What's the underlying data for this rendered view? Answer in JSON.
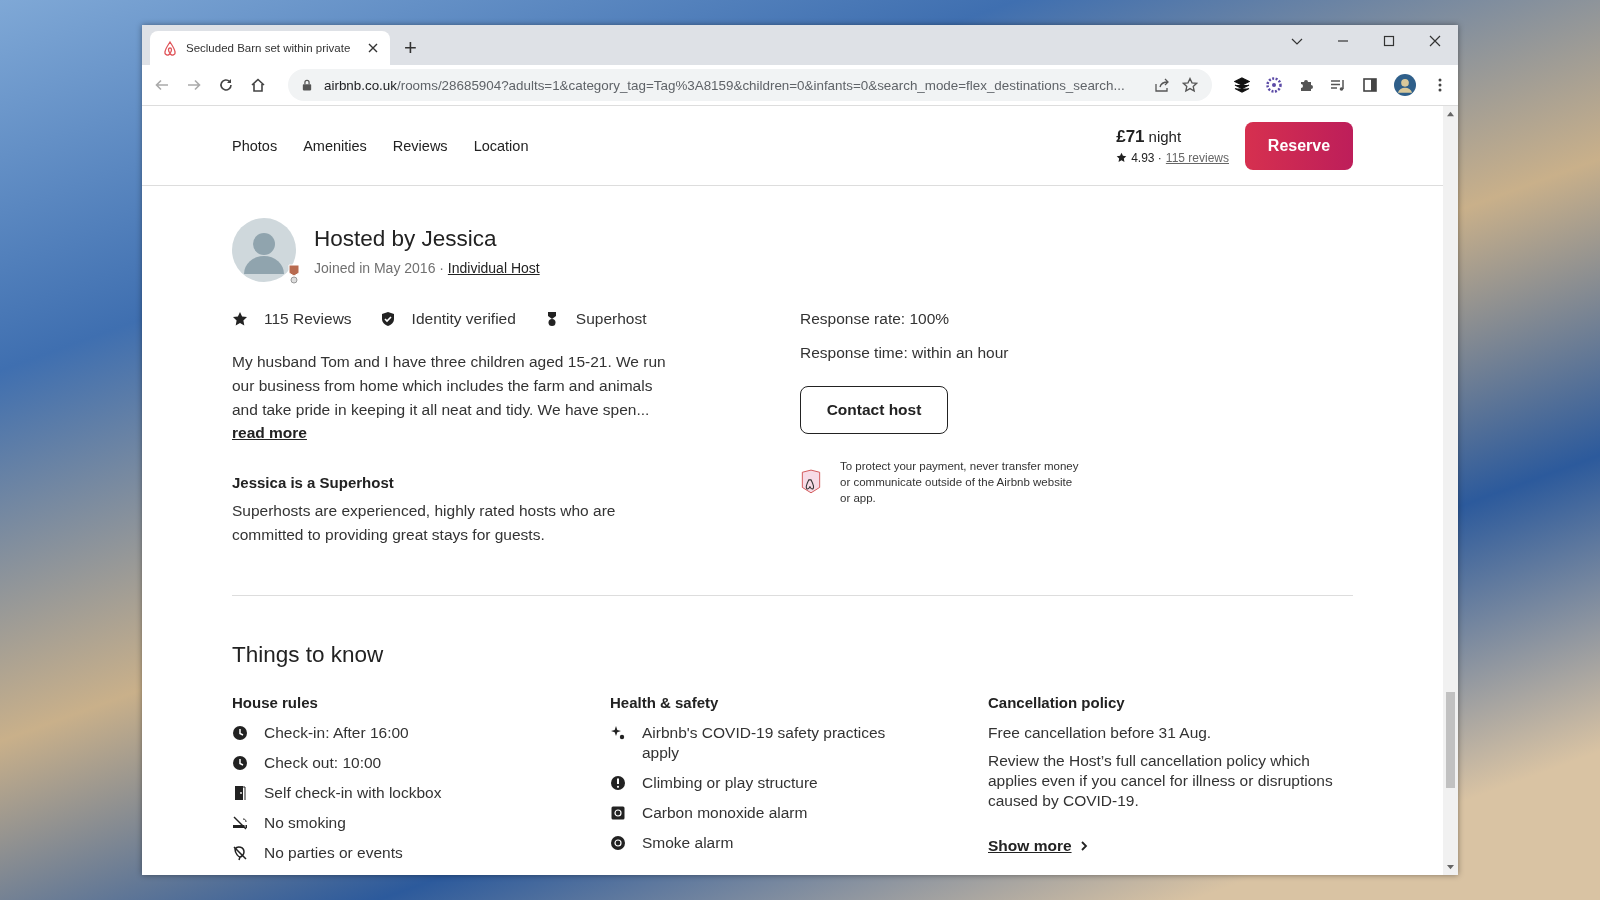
{
  "browser": {
    "tab": {
      "title": "Secluded Barn set within private",
      "selected": true
    },
    "new_tab": "+",
    "url_host": "airbnb.co.uk",
    "url_path": "/rooms/28685904?adults=1&category_tag=Tag%3A8159&children=0&infants=0&search_mode=flex_destinations_search..."
  },
  "nav": {
    "links": [
      "Photos",
      "Amenities",
      "Reviews",
      "Location"
    ],
    "price": "£71",
    "price_unit": "night",
    "rating": "4.93 ·",
    "reviews_link": "115 reviews",
    "reserve": "Reserve"
  },
  "host": {
    "title": "Hosted by Jessica",
    "joined": "Joined in May 2016 ·",
    "host_type": "Individual Host",
    "stats": [
      "115 Reviews",
      "Identity verified",
      "Superhost"
    ],
    "about": "My husband Tom and I have three children aged 15-21. We run our business from home which includes the farm and animals and take pride in keeping it all neat and tidy. We have spen...",
    "read_more": "read more",
    "superhost_title": "Jessica is a Superhost",
    "superhost_text": "Superhosts are experienced, highly rated hosts who are committed to providing great stays for guests.",
    "response_rate": "Response rate: 100%",
    "response_time": "Response time: within an hour",
    "contact": "Contact host",
    "payment_notice": "To protect your payment, never transfer money or communicate outside of the Airbnb website or app."
  },
  "things_to_know": {
    "title": "Things to know",
    "house_rules": {
      "title": "House rules",
      "items": [
        {
          "kind": "clock",
          "text": "Check-in: After 16:00"
        },
        {
          "kind": "clock",
          "text": "Check out: 10:00"
        },
        {
          "kind": "door",
          "text": "Self check-in with lockbox"
        },
        {
          "kind": "nosmoking",
          "text": "No smoking"
        },
        {
          "kind": "noparty",
          "text": "No parties or events"
        }
      ]
    },
    "health_safety": {
      "title": "Health & safety",
      "items": [
        {
          "kind": "sparkle",
          "text": "Airbnb's COVID-19 safety practices apply"
        },
        {
          "kind": "alert",
          "text": "Climbing or play structure"
        },
        {
          "kind": "co",
          "text": "Carbon monoxide alarm"
        },
        {
          "kind": "smoke",
          "text": "Smoke alarm"
        }
      ]
    },
    "cancellation": {
      "title": "Cancellation policy",
      "lines": [
        "Free cancellation before 31 Aug.",
        "Review the Host’s full cancellation policy which applies even if you cancel for illness or disruptions caused by COVID-19."
      ],
      "show_more": "Show more"
    }
  }
}
